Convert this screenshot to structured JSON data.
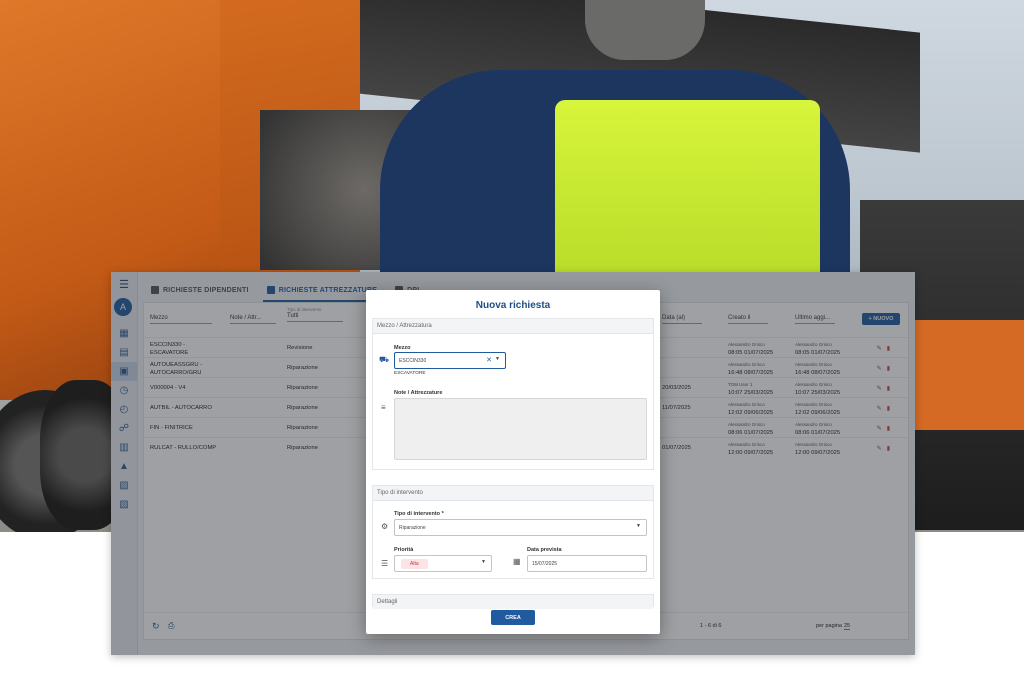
{
  "app": {
    "avatar_initial": "A",
    "tabs": [
      {
        "label": "RICHIESTE DIPENDENTI",
        "active": false
      },
      {
        "label": "RICHIESTE ATTREZZATURE",
        "active": true
      },
      {
        "label": "DPI",
        "active": false
      }
    ],
    "new_button": "+ NUOVO",
    "columns": {
      "mezzo": "Mezzo",
      "note": "Note / Attr...",
      "tipo_sub": "Tipo di intervento",
      "tipo": "Tutti",
      "data": "Data (al)",
      "creato": "Creato il",
      "ultimo": "Ultimo aggi..."
    },
    "rows": [
      {
        "mezzo": "ESCCIN330 - ESCAVATORE",
        "tipo": "Revisione",
        "data": "",
        "creato_by": "Alessandro Grisco",
        "creato_at": "08:05 01/07/2025",
        "ultimo_by": "Alessandro Grisco",
        "ultimo_at": "08:05 01/07/2025"
      },
      {
        "mezzo": "AUTOUEASSGRU - AUTOCARRO/GRU",
        "tipo": "Riparazione",
        "data": "",
        "creato_by": "Alessandro Grisco",
        "creato_at": "16:48 08/07/2025",
        "ultimo_by": "Alessandro Grisco",
        "ultimo_at": "16:48 08/07/2025"
      },
      {
        "mezzo": "V000004 - V4",
        "tipo": "Riparazione",
        "data": "20/03/2025",
        "creato_by": "TOM User 1",
        "creato_at": "10:07 25/03/2025",
        "ultimo_by": "Alessandro Grisco",
        "ultimo_at": "10:07 25/03/2025"
      },
      {
        "mezzo": "AUTBIL - AUTOCARRO",
        "tipo": "Riparazione",
        "data": "11/07/2025",
        "creato_by": "Alessandro Grisco",
        "creato_at": "12:02 09/06/2025",
        "ultimo_by": "Alessandro Grisco",
        "ultimo_at": "12:02 09/06/2025"
      },
      {
        "mezzo": "FIN - FINITRICE",
        "tipo": "Riparazione",
        "data": "",
        "creato_by": "Alessandro Grisco",
        "creato_at": "08:06 01/07/2025",
        "ultimo_by": "Alessandro Grisco",
        "ultimo_at": "08:06 01/07/2025"
      },
      {
        "mezzo": "RULCAT - RULLO/COMP",
        "tipo": "Riparazione",
        "data": "01/07/2025",
        "creato_by": "Alessandro Grisco",
        "creato_at": "12:00 09/07/2025",
        "ultimo_by": "Alessandro Grisco",
        "ultimo_at": "12:00 09/07/2025"
      }
    ],
    "pagination": "1 - 6 di 6",
    "per_page_label": "per pagina",
    "per_page_value": "25"
  },
  "modal": {
    "title": "Nuova richiesta",
    "section_mezzo": "Mezzo / Attrezzatura",
    "mezzo_label": "Mezzo",
    "mezzo_value": "ESCCIN330",
    "mezzo_helper": "ESCAVATORE",
    "note_label": "Note / Attrezzature",
    "section_tipo": "Tipo di intervento",
    "tipo_label": "Tipo di intervento *",
    "tipo_value": "Riparazione",
    "priorita_label": "Priorità",
    "priorita_value": "Alta",
    "data_label": "Data prevista",
    "data_value": "15/07/2025",
    "section_dettagli": "Dettagli",
    "crea_button": "CREA"
  },
  "icons": {
    "menu": "menu-icon",
    "truck": "truck-icon",
    "notes": "notes-icon",
    "wrench": "wrench-icon",
    "priority": "priority-icon",
    "calendar": "calendar-icon",
    "refresh": "refresh-icon",
    "print": "print-icon",
    "edit": "edit-icon",
    "delete": "delete-icon"
  },
  "colors": {
    "primary": "#1f5b9e",
    "danger": "#d23c3c",
    "chip_bg": "#fbe3e6"
  }
}
